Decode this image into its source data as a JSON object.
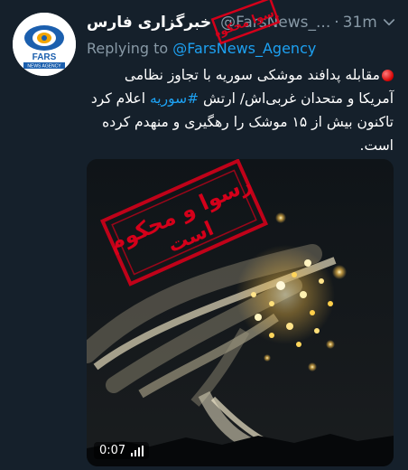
{
  "tweet": {
    "author_name": "خبرگزاری فارس",
    "handle": "@FarsNews_...",
    "separator": "·",
    "time": "31m",
    "replying_to_prefix": "Replying to",
    "replying_to_handle": "@FarsNews_Agency",
    "text_part1": "مقابله پدافند موشکی سوریه با تجاوز نظامی آمریکا و متحدان غربی‌اش/ ارتش",
    "hashtag": "#سوریه",
    "text_part2": "اعلام کرد تاکنون بیش از ۱۵ موشک را رهگیری و منهدم کرده است."
  },
  "avatar": {
    "logo_text": "FARS",
    "logo_subtext": "NEWS AGENCY"
  },
  "media": {
    "duration": "0:07",
    "stamp_text_line1": "رسوا و محکوم",
    "stamp_text_line2": "است",
    "stamp_top_text": "رسوا محکوم"
  },
  "icons": {
    "verified": "verified-badge-icon",
    "chevron": "chevron-down-icon",
    "audio": "audio-bars-icon"
  },
  "colors": {
    "background": "#15202b",
    "link": "#1da1f2",
    "muted": "#8899a6",
    "stamp_red": "#d4001a"
  }
}
